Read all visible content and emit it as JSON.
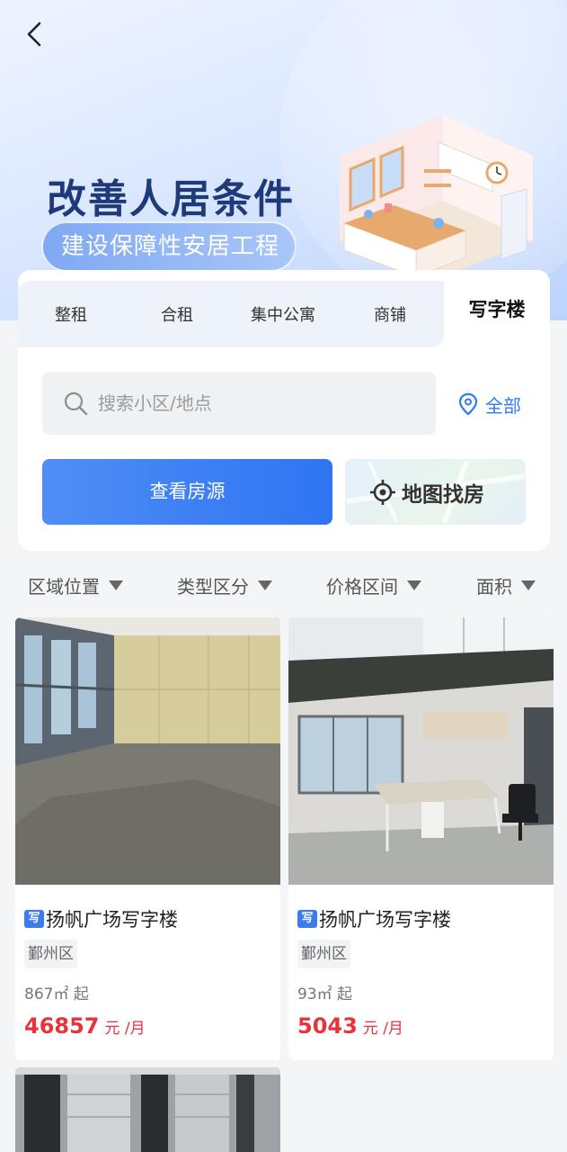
{
  "banner": {
    "title": "改善人居条件",
    "subtitle": "建设保障性安居工程"
  },
  "tabs": [
    {
      "label": "整租",
      "active": false
    },
    {
      "label": "合租",
      "active": false
    },
    {
      "label": "集中公寓",
      "active": false
    },
    {
      "label": "商铺",
      "active": false
    },
    {
      "label": "写字楼",
      "active": true
    }
  ],
  "search": {
    "placeholder": "搜索小区/地点",
    "value": ""
  },
  "location_filter": "全部",
  "buttons": {
    "view_listings": "查看房源",
    "map_search": "地图找房"
  },
  "filters": [
    "区域位置",
    "类型区分",
    "价格区间",
    "面积"
  ],
  "listings": [
    {
      "tag": "写",
      "title": "扬帆广场写字楼",
      "district": "鄞州区",
      "area": "867㎡ 起",
      "price": "46857",
      "unit": "元 /月"
    },
    {
      "tag": "写",
      "title": "扬帆广场写字楼",
      "district": "鄞州区",
      "area": "93㎡ 起",
      "price": "5043",
      "unit": "元 /月"
    }
  ],
  "colors": {
    "accent": "#2f7bf0",
    "price": "#e8323c",
    "banner_text": "#1f3a7a"
  }
}
